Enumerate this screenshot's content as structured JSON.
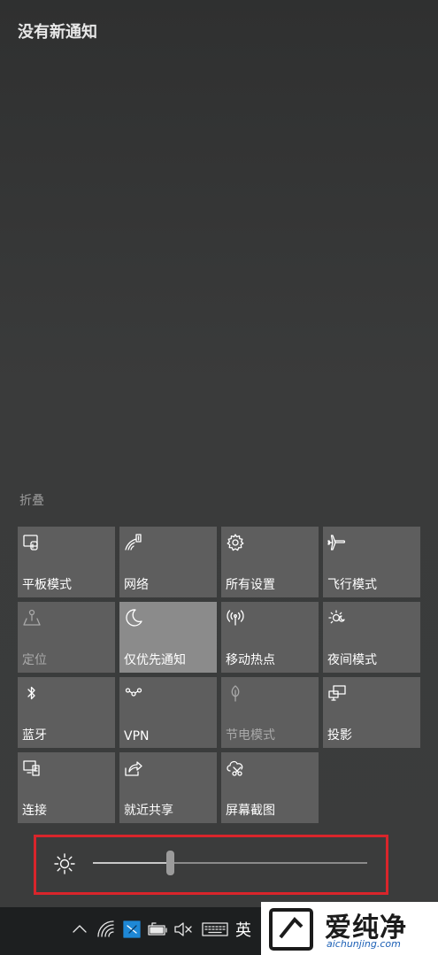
{
  "notifications": {
    "title": "没有新通知",
    "collapse_label": "折叠"
  },
  "quick_actions": [
    {
      "label": "平板模式",
      "icon": "tablet-mode-icon",
      "state": "normal"
    },
    {
      "label": "网络",
      "icon": "network-icon",
      "state": "normal"
    },
    {
      "label": "所有设置",
      "icon": "settings-gear-icon",
      "state": "normal"
    },
    {
      "label": "飞行模式",
      "icon": "airplane-icon",
      "state": "normal"
    },
    {
      "label": "定位",
      "icon": "location-icon",
      "state": "disabled"
    },
    {
      "label": "仅优先通知",
      "icon": "moon-icon",
      "state": "active"
    },
    {
      "label": "移动热点",
      "icon": "hotspot-icon",
      "state": "normal"
    },
    {
      "label": "夜间模式",
      "icon": "night-light-icon",
      "state": "normal"
    },
    {
      "label": "蓝牙",
      "icon": "bluetooth-icon",
      "state": "normal"
    },
    {
      "label": "VPN",
      "icon": "vpn-icon",
      "state": "normal"
    },
    {
      "label": "节电模式",
      "icon": "battery-saver-icon",
      "state": "disabled"
    },
    {
      "label": "投影",
      "icon": "project-icon",
      "state": "normal"
    },
    {
      "label": "连接",
      "icon": "connect-icon",
      "state": "normal"
    },
    {
      "label": "就近共享",
      "icon": "nearby-share-icon",
      "state": "normal"
    },
    {
      "label": "屏幕截图",
      "icon": "screen-snip-icon",
      "state": "normal"
    }
  ],
  "brightness": {
    "icon": "brightness-sun-icon",
    "level_percent": 28,
    "highlight_color": "#d9252b"
  },
  "taskbar": {
    "icons": [
      "show-hidden-icons-chevron-icon",
      "wifi-icon",
      "app-tray-icon",
      "battery-icon",
      "volume-muted-icon",
      "keyboard-icon"
    ],
    "ime_label": "英"
  },
  "watermark": {
    "name": "爱纯净",
    "url": "aichunjing.com"
  },
  "colors": {
    "tile": "#5e5e5e",
    "tile_active": "#8b8b8b",
    "background": "#3a3b3b",
    "taskbar": "#1d1f20"
  }
}
